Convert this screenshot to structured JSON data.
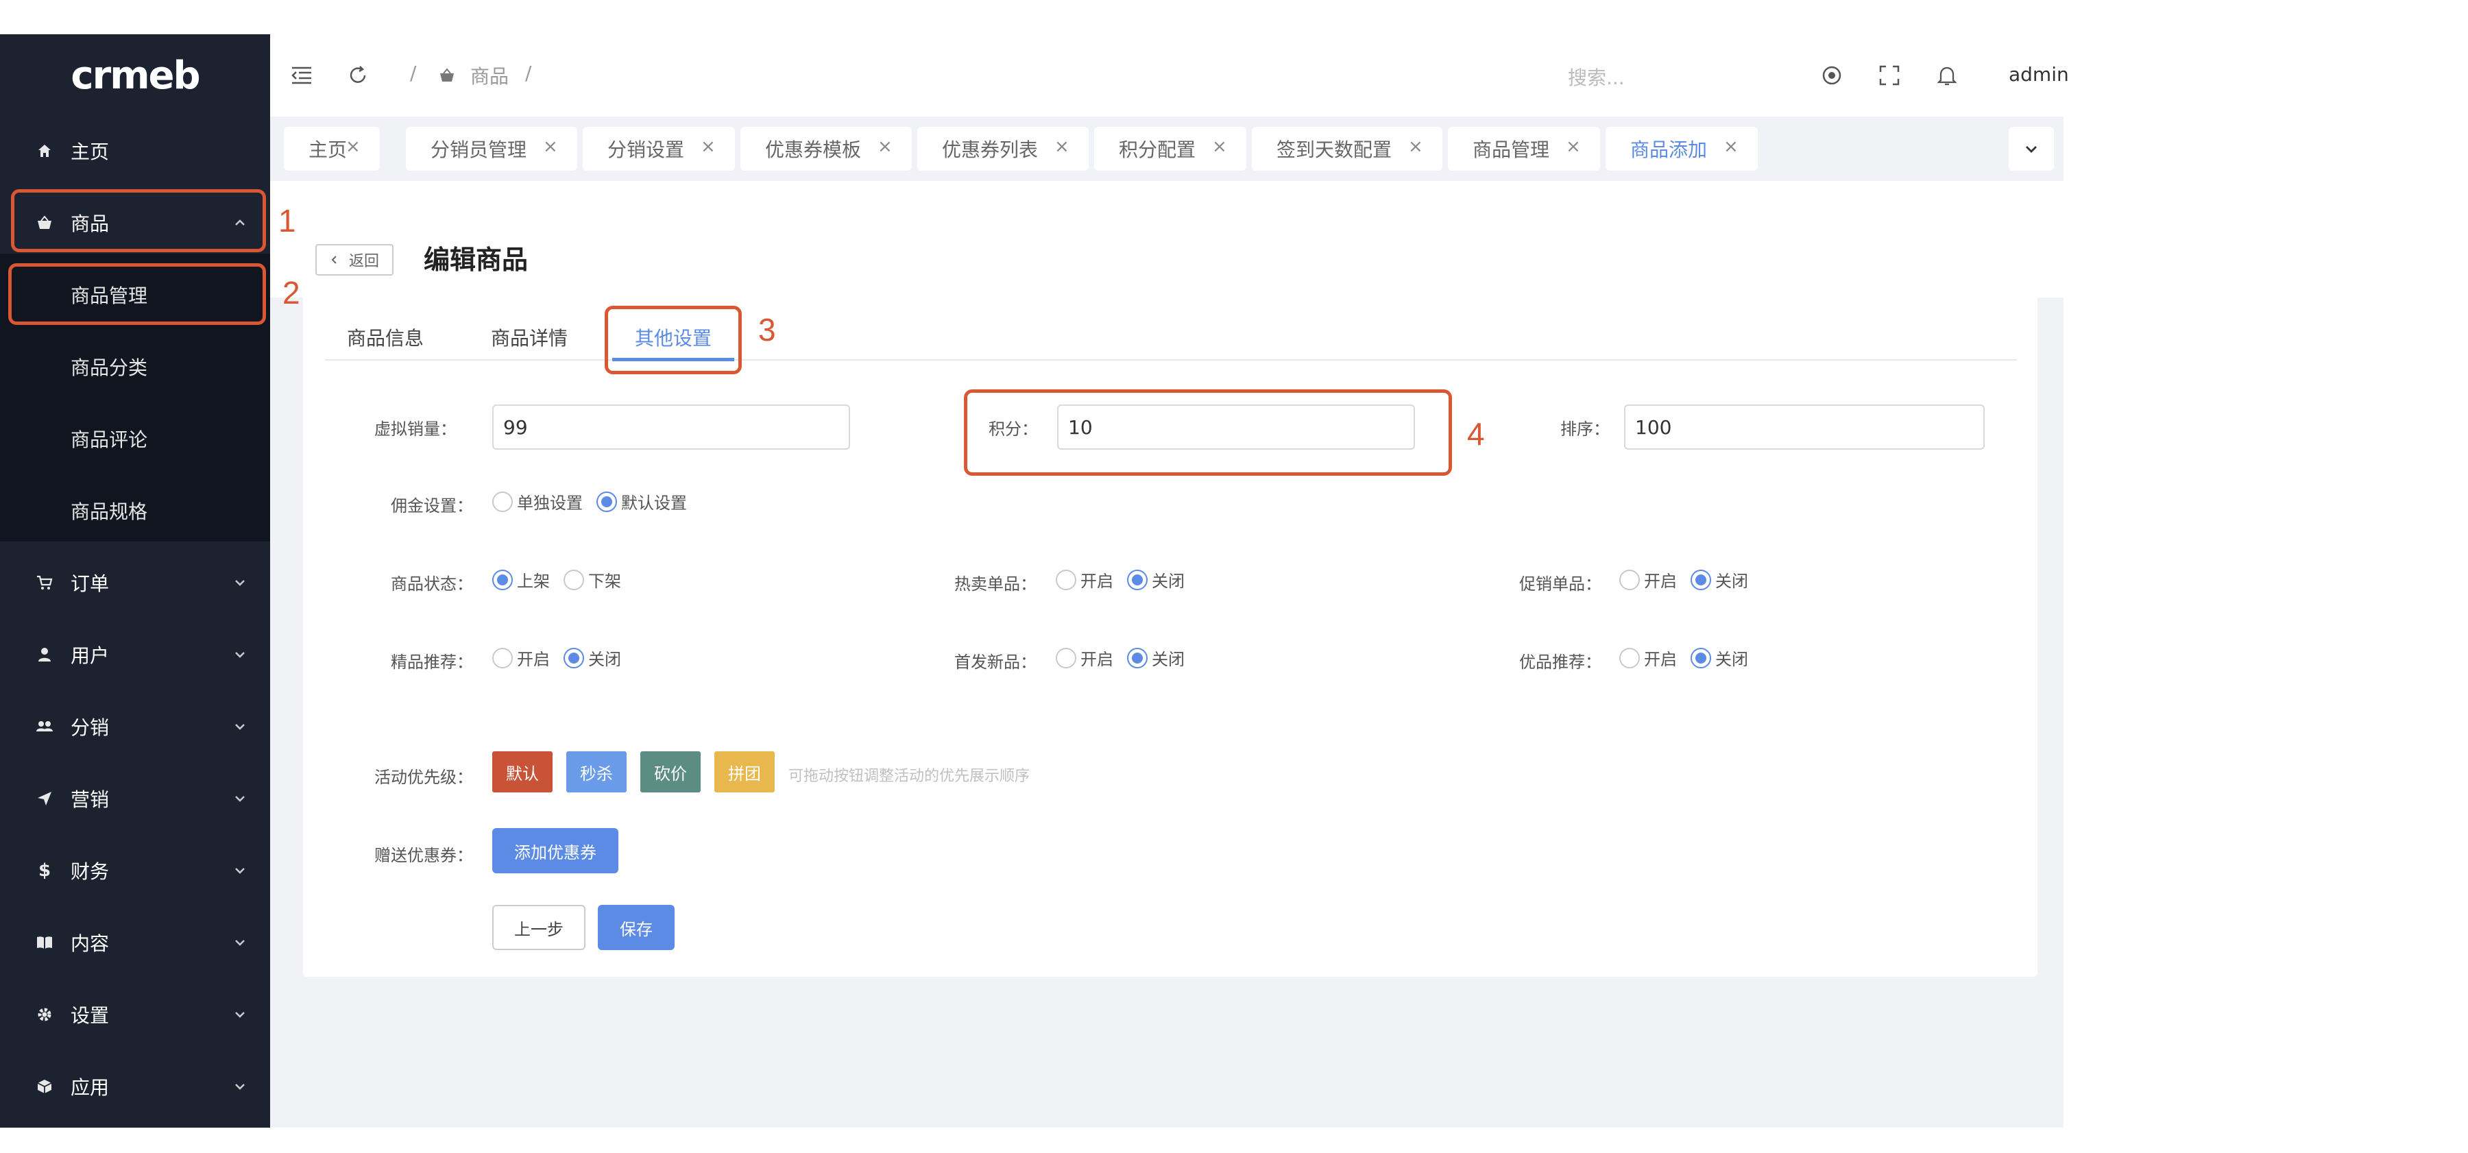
{
  "app": {
    "logo_text": "crmeb"
  },
  "sidebar": {
    "items": [
      {
        "label": "主页",
        "icon": "home-icon"
      },
      {
        "label": "商品",
        "icon": "basket-icon",
        "expanded": true
      },
      {
        "label": "订单",
        "icon": "cart-icon"
      },
      {
        "label": "用户",
        "icon": "user-icon"
      },
      {
        "label": "分销",
        "icon": "group-icon"
      },
      {
        "label": "营销",
        "icon": "send-icon"
      },
      {
        "label": "财务",
        "icon": "dollar-icon"
      },
      {
        "label": "内容",
        "icon": "book-icon"
      },
      {
        "label": "设置",
        "icon": "gear-icon"
      },
      {
        "label": "应用",
        "icon": "box-icon"
      }
    ],
    "submenu": [
      "商品管理",
      "商品分类",
      "商品评论",
      "商品规格"
    ]
  },
  "header": {
    "breadcrumb_sep1": "/",
    "breadcrumb_item": "商品",
    "breadcrumb_sep2": "/",
    "search_placeholder": "搜索...",
    "user": "admin"
  },
  "tabs": [
    {
      "label": "主页"
    },
    {
      "label": "分销员管理"
    },
    {
      "label": "分销设置"
    },
    {
      "label": "优惠券模板"
    },
    {
      "label": "优惠券列表"
    },
    {
      "label": "积分配置"
    },
    {
      "label": "签到天数配置"
    },
    {
      "label": "商品管理"
    },
    {
      "label": "商品添加",
      "active": true
    }
  ],
  "page": {
    "back_label": "返回",
    "title": "编辑商品"
  },
  "content_tabs": [
    {
      "label": "商品信息"
    },
    {
      "label": "商品详情"
    },
    {
      "label": "其他设置",
      "active": true
    }
  ],
  "form": {
    "virtual_sales": {
      "label": "虚拟销量：",
      "value": "99"
    },
    "points": {
      "label": "积分：",
      "value": "10"
    },
    "sort": {
      "label": "排序：",
      "value": "100"
    },
    "commission": {
      "label": "佣金设置：",
      "options": [
        "单独设置",
        "默认设置"
      ],
      "selected": 1
    },
    "status": {
      "label": "商品状态：",
      "options": [
        "上架",
        "下架"
      ],
      "selected": 0
    },
    "hot": {
      "label": "热卖单品：",
      "options": [
        "开启",
        "关闭"
      ],
      "selected": 1
    },
    "promo": {
      "label": "促销单品：",
      "options": [
        "开启",
        "关闭"
      ],
      "selected": 1
    },
    "best": {
      "label": "精品推荐：",
      "options": [
        "开启",
        "关闭"
      ],
      "selected": 1
    },
    "new": {
      "label": "首发新品：",
      "options": [
        "开启",
        "关闭"
      ],
      "selected": 1
    },
    "good": {
      "label": "优品推荐：",
      "options": [
        "开启",
        "关闭"
      ],
      "selected": 1
    },
    "priority": {
      "label": "活动优先级：",
      "buttons": [
        {
          "label": "默认",
          "color": "#c95337"
        },
        {
          "label": "秒杀",
          "color": "#6a9be8"
        },
        {
          "label": "砍价",
          "color": "#5b8d84"
        },
        {
          "label": "拼团",
          "color": "#e8b84f"
        }
      ],
      "hint": "可拖动按钮调整活动的优先展示顺序"
    },
    "coupon": {
      "label": "赠送优惠券：",
      "button": "添加优惠券"
    },
    "prev_button": "上一步",
    "save_button": "保存"
  },
  "annotations": [
    "1",
    "2",
    "3",
    "4"
  ],
  "colors": {
    "accent": "#5b8be5",
    "highlight": "#d95733",
    "sidebar": "#1c2230"
  }
}
